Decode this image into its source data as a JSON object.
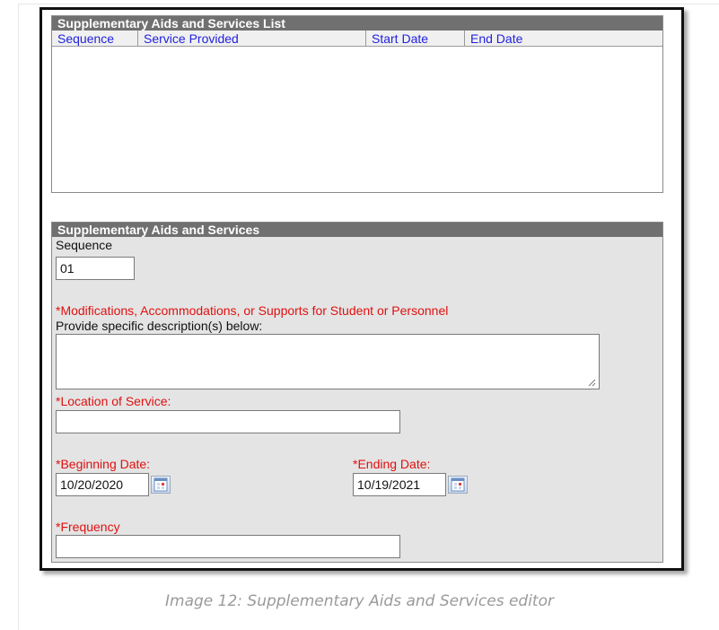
{
  "list_panel": {
    "title": "Supplementary Aids and Services List",
    "columns": [
      "Sequence",
      "Service Provided",
      "Start Date",
      "End Date"
    ]
  },
  "form_panel": {
    "title": "Supplementary Aids and Services",
    "sequence": {
      "label": "Sequence",
      "value": "01"
    },
    "modifications": {
      "label": "*Modifications, Accommodations, or Supports for Student or Personnel",
      "sublabel": "Provide specific description(s) below:",
      "value": ""
    },
    "location": {
      "label": "*Location of Service:",
      "value": ""
    },
    "beginning_date": {
      "label": "*Beginning Date:",
      "value": "10/20/2020",
      "icon": "calendar-icon"
    },
    "ending_date": {
      "label": "*Ending Date:",
      "value": "10/19/2021",
      "icon": "calendar-icon"
    },
    "frequency": {
      "label": "*Frequency",
      "value": ""
    }
  },
  "caption": "Image 12: Supplementary Aids and Services editor",
  "colors": {
    "header_bg": "#707070",
    "column_text": "#2222dd",
    "required_text": "#e01010",
    "form_bg": "#e4e4e4"
  }
}
